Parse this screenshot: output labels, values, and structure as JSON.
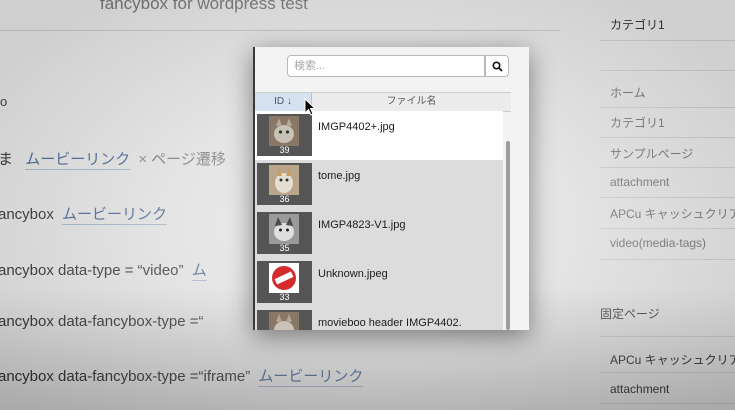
{
  "background": {
    "title": "fancybox for wordpress test",
    "marker": "o",
    "lines": [
      {
        "prefix": "ま",
        "link": "ムービーリンク",
        "sep": "×",
        "tail": "ページ遷移"
      },
      {
        "prefix": "ancybox",
        "link": "ムービーリンク"
      },
      {
        "prefix": "ancybox data-type = “video”",
        "link": "ム"
      },
      {
        "prefix": "ancybox data-fancybox-type =“",
        "link": ""
      },
      {
        "prefix": "ancybox data-fancybox-type =“iframe”",
        "link": "ムービーリンク"
      }
    ]
  },
  "sidebar": {
    "top_item": "カテゴリ1",
    "items": [
      "ホーム",
      "カテゴリ1",
      "サンプルページ",
      "attachment",
      "APCu キャッシュクリア",
      "video(media-tags)"
    ],
    "fixed_heading": "固定ページ",
    "fixed_items": [
      "APCu キャッシュクリア",
      "attachment"
    ]
  },
  "popup": {
    "search_placeholder": "検索...",
    "search_icon": "search-icon",
    "columns": {
      "id": "ID ↓",
      "name": "ファイル名"
    },
    "rows": [
      {
        "id": "39",
        "name": "IMGP4402+.jpg",
        "thumb": "cat-photo"
      },
      {
        "id": "36",
        "name": "tome.jpg",
        "thumb": "cat-photo"
      },
      {
        "id": "35",
        "name": "IMGP4823-V1.jpg",
        "thumb": "cat-photo-bw"
      },
      {
        "id": "33",
        "name": "Unknown.jpeg",
        "thumb": "no-entry-icon"
      },
      {
        "id": "",
        "name": "movieboo header IMGP4402.",
        "thumb": "cat-photo"
      }
    ]
  },
  "colors": {
    "header_sort": "#d6e2f0",
    "link": "#3a5a86",
    "no_entry": "#d42b2b"
  }
}
